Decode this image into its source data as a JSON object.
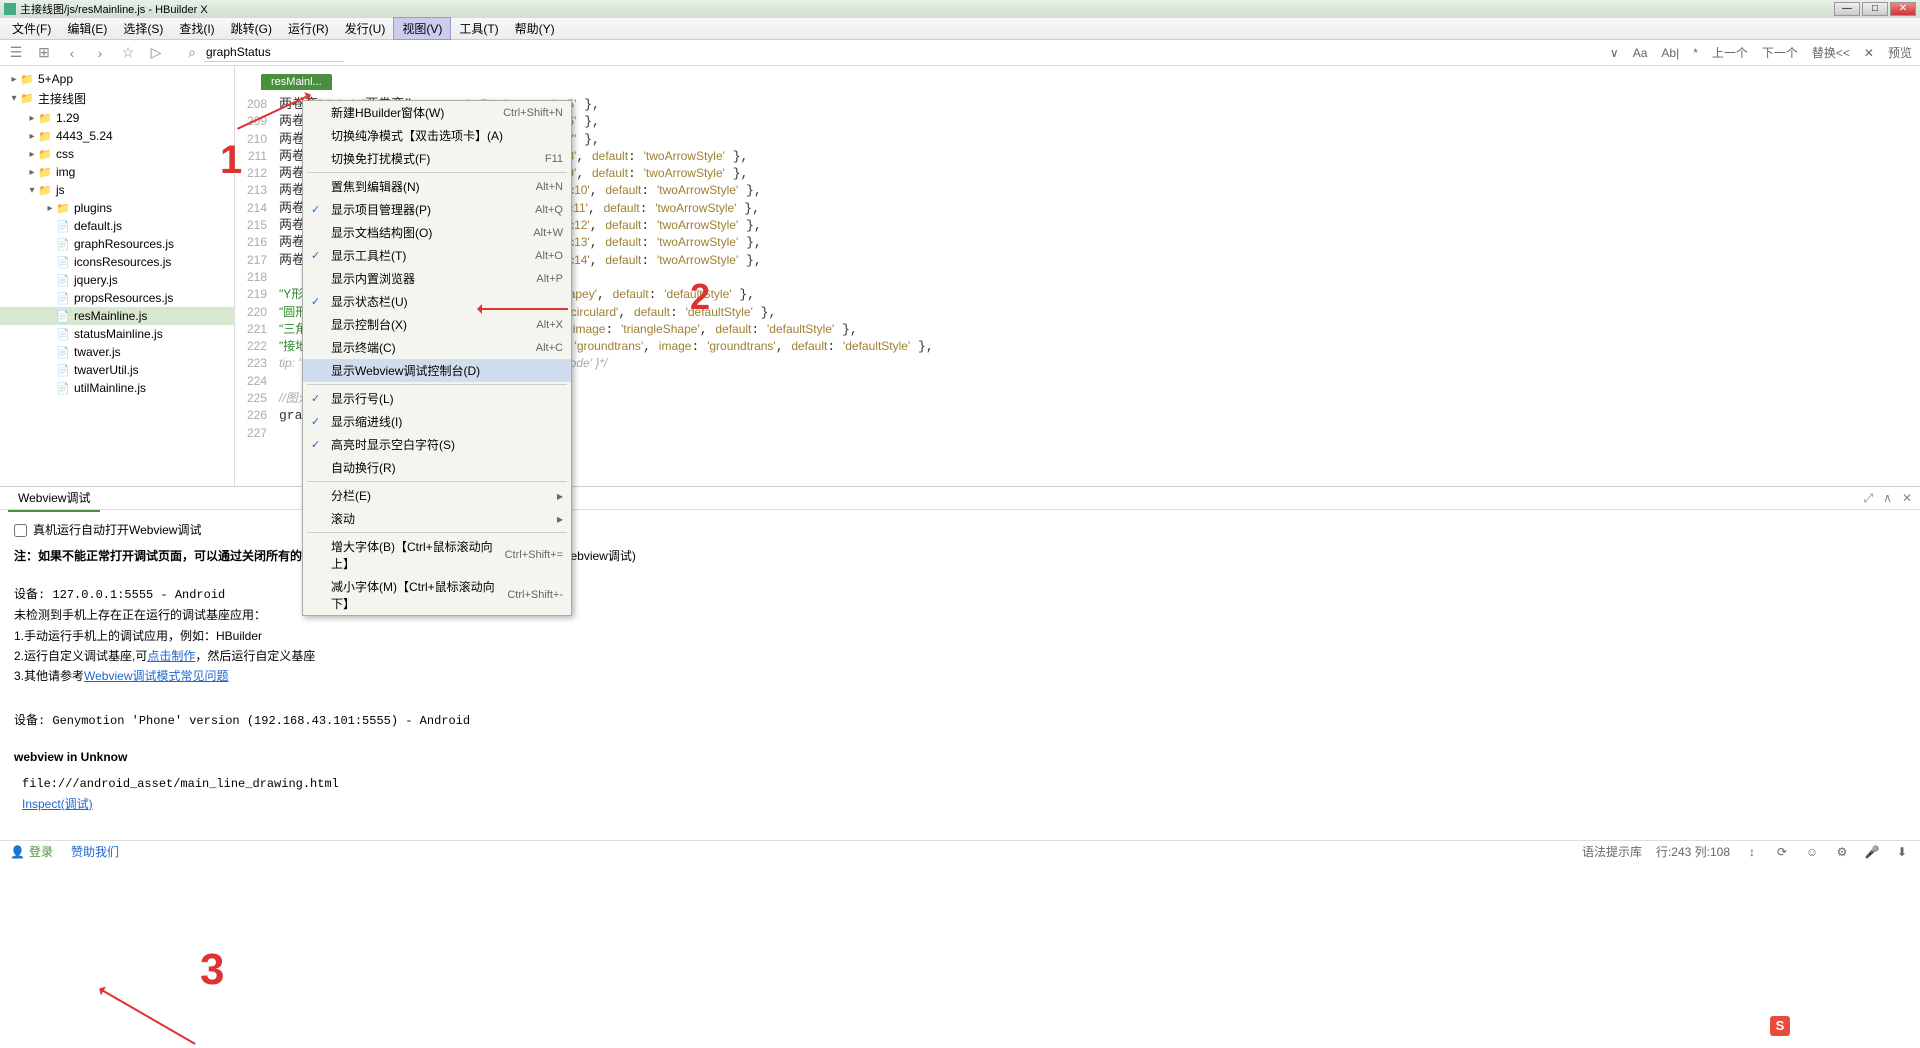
{
  "window": {
    "title": "主接线图/js/resMainline.js - HBuilder X",
    "controls": {
      "min": "—",
      "max": "□",
      "close": "✕"
    }
  },
  "menubar": [
    "文件(F)",
    "编辑(E)",
    "选择(S)",
    "查找(I)",
    "跳转(G)",
    "运行(R)",
    "发行(U)",
    "视图(V)",
    "工具(T)",
    "帮助(Y)"
  ],
  "toolbar": {
    "search_value": "graphStatus",
    "find_opts": [
      "Aa",
      "Ab|",
      "*",
      "上一个",
      "下一个",
      "替换<<",
      "✕",
      "预览"
    ]
  },
  "dropdown": [
    {
      "type": "item",
      "label": "新建HBuilder窗体(W)",
      "shortcut": "Ctrl+Shift+N"
    },
    {
      "type": "item",
      "label": "切换纯净模式【双击选项卡】(A)"
    },
    {
      "type": "item",
      "label": "切换免打扰模式(F)",
      "shortcut": "F11"
    },
    {
      "type": "sep"
    },
    {
      "type": "item",
      "label": "置焦到编辑器(N)",
      "shortcut": "Alt+N"
    },
    {
      "type": "item",
      "label": "显示项目管理器(P)",
      "shortcut": "Alt+Q",
      "checked": true
    },
    {
      "type": "item",
      "label": "显示文档结构图(O)",
      "shortcut": "Alt+W"
    },
    {
      "type": "item",
      "label": "显示工具栏(T)",
      "shortcut": "Alt+O",
      "checked": true
    },
    {
      "type": "item",
      "label": "显示内置浏览器",
      "shortcut": "Alt+P"
    },
    {
      "type": "item",
      "label": "显示状态栏(U)",
      "checked": true
    },
    {
      "type": "item",
      "label": "显示控制台(X)",
      "shortcut": "Alt+X"
    },
    {
      "type": "item",
      "label": "显示终端(C)",
      "shortcut": "Alt+C"
    },
    {
      "type": "item",
      "label": "显示Webview调试控制台(D)",
      "hl": true
    },
    {
      "type": "sep"
    },
    {
      "type": "item",
      "label": "显示行号(L)",
      "checked": true
    },
    {
      "type": "item",
      "label": "显示缩进线(I)",
      "checked": true
    },
    {
      "type": "item",
      "label": "高亮时显示空白字符(S)",
      "checked": true
    },
    {
      "type": "item",
      "label": "自动换行(R)"
    },
    {
      "type": "sep"
    },
    {
      "type": "item",
      "label": "分栏(E)",
      "submenu": true
    },
    {
      "type": "item",
      "label": "滚动",
      "submenu": true
    },
    {
      "type": "sep"
    },
    {
      "type": "item",
      "label": "增大字体(B)【Ctrl+鼠标滚动向上】",
      "shortcut": "Ctrl+Shift+="
    },
    {
      "type": "item",
      "label": "减小字体(M)【Ctrl+鼠标滚动向下】",
      "shortcut": "Ctrl+Shift+-"
    }
  ],
  "sidebar": {
    "items": [
      {
        "depth": 0,
        "exp": ">",
        "icon": "folder",
        "label": "5+App"
      },
      {
        "depth": 0,
        "exp": "v",
        "icon": "folder",
        "label": "主接线图"
      },
      {
        "depth": 1,
        "exp": ">",
        "icon": "folder",
        "label": "1.29"
      },
      {
        "depth": 1,
        "exp": ">",
        "icon": "folder",
        "label": "4443_5.24"
      },
      {
        "depth": 1,
        "exp": ">",
        "icon": "folder",
        "label": "css"
      },
      {
        "depth": 1,
        "exp": ">",
        "icon": "folder",
        "label": "img"
      },
      {
        "depth": 1,
        "exp": "v",
        "icon": "folder",
        "label": "js"
      },
      {
        "depth": 2,
        "exp": ">",
        "icon": "folder",
        "label": "plugins"
      },
      {
        "depth": 2,
        "exp": "",
        "icon": "js",
        "label": "default.js"
      },
      {
        "depth": 2,
        "exp": "",
        "icon": "js",
        "label": "graphResources.js"
      },
      {
        "depth": 2,
        "exp": "",
        "icon": "js",
        "label": "iconsResources.js"
      },
      {
        "depth": 2,
        "exp": "",
        "icon": "js",
        "label": "jquery.js"
      },
      {
        "depth": 2,
        "exp": "",
        "icon": "js",
        "label": "propsResources.js"
      },
      {
        "depth": 2,
        "exp": "",
        "icon": "js",
        "label": "resMainline.js",
        "selected": true
      },
      {
        "depth": 2,
        "exp": "",
        "icon": "js",
        "label": "statusMainline.js"
      },
      {
        "depth": 2,
        "exp": "",
        "icon": "js",
        "label": "twaver.js"
      },
      {
        "depth": 2,
        "exp": "",
        "icon": "js",
        "label": "twaverUtil.js"
      },
      {
        "depth": 2,
        "exp": "",
        "icon": "js",
        "label": "utilMainline.js"
      }
    ]
  },
  "editor": {
    "tab": "resMainl...",
    "line_start": 208,
    "line_end": 227,
    "lines": [
      "两卷变\", label: \"两卷变\", type: 'vc5', image: 'vc5' },",
      "两卷变\", label: \"两卷变\", type: 'vc6', image: 'vc6' },",
      "两卷变\", label: \"两卷变\", type: 'vc7', image: 'vc7' },",
      "两卷变\", label: \"两卷变\", type: 'vc8', image: 'vc8', default: 'twoArrowStyle' },",
      "两卷变\", label: \"两卷变\", type: 'vc9', image: 'vc9', default: 'twoArrowStyle' },",
      "两卷变\", label: \"两卷变\", type: 'vc10', image: 'vc10', default: 'twoArrowStyle' },",
      "两卷变\", label: \"两卷变\", type: 'vc11', image: 'vc11', default: 'twoArrowStyle' },",
      "两卷变\", label: \"两卷变\", type: 'vc12', image: 'vc12', default: 'twoArrowStyle' },",
      "两卷变\", label: \"两卷变\", type: 'vc13', image: 'vc13', default: 'twoArrowStyle' },",
      "两卷变\", label: \"两卷变\", type: 'vc14', image: 'vc14', default: 'twoArrowStyle' },",
      "",
      "\"Y形\", label: \"Y形\", type: 'shapey', image: 'shapey', default: 'defaultStyle' },",
      "\"圆形\", label: \"圆形\", type: 'circulard', image: 'circulard', default: 'defaultStyle' },",
      "\"三角形\", label: \"三角形\", type: 'triangleShape', image: 'triangleShape', default: 'defaultStyle' },",
      "\"接地变分解图元\", label: \"接地变分解图元\", type: 'groundtrans', image: 'groundtrans', default: 'defaultStyle' },",
      "tip: \"测试\", label: \"测试2\", type: 'testnode', image: 'testnode' }*/",
      "",
      "//图元样式属性关系",
      "graphProperties: {"
    ]
  },
  "panel": {
    "tab": "Webview调试",
    "checkbox_label": "真机运行自动打开Webview调试",
    "note_prefix": "注：如果不能正常打开调试页面，可以通过关闭所有的Chrome进程，然后重试！",
    "note_suffix": "(注：uni-app暂不支持Webview调试)",
    "device1": "设备: 127.0.0.1:5555 - Android",
    "nodetect": "未检测到手机上存在正在运行的调试基座应用：",
    "step1": "1.手动运行手机上的调试应用，例如：HBuilder",
    "step2_a": "2.运行自定义调试基座,可",
    "step2_link": "点击制作",
    "step2_b": "，然后运行自定义基座",
    "step3_a": "3.其他请参考",
    "step3_link": "Webview调试模式常见问题",
    "device2": "设备: Genymotion 'Phone' version (192.168.43.101:5555) - Android",
    "webview_title": "webview in Unknow",
    "webview_url": "file:///android_asset/main_line_drawing.html",
    "inspect": "Inspect(调试)"
  },
  "statusbar": {
    "login": "登录",
    "donate": "赞助我们",
    "syntax": "语法提示库",
    "cursor": "行:243  列:108"
  },
  "annotations": {
    "n1": "1",
    "n2": "2",
    "n3": "3"
  }
}
